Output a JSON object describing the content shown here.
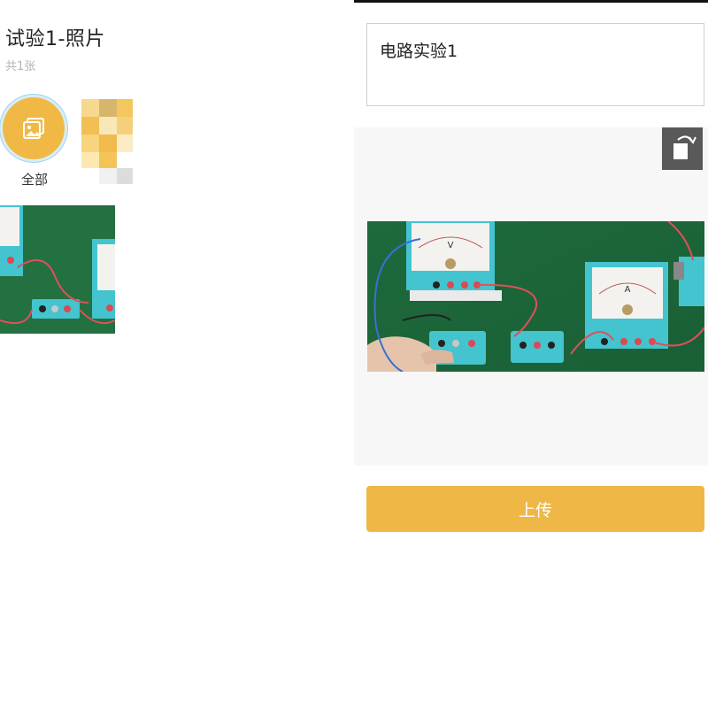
{
  "album": {
    "title": "试验1-照片",
    "count": "共1张",
    "all_label": "全部"
  },
  "form": {
    "title_value": "电路实验1",
    "upload_label": "上传"
  },
  "photo_meters": {
    "voltmeter_letter": "V",
    "ammeter_letter": "A"
  },
  "colors": {
    "accent": "#f0b945",
    "upload_button": "#efb746",
    "rotate_button": "#595959",
    "table_green": "#1f6b3e",
    "instrument_teal": "#43c4cf"
  }
}
